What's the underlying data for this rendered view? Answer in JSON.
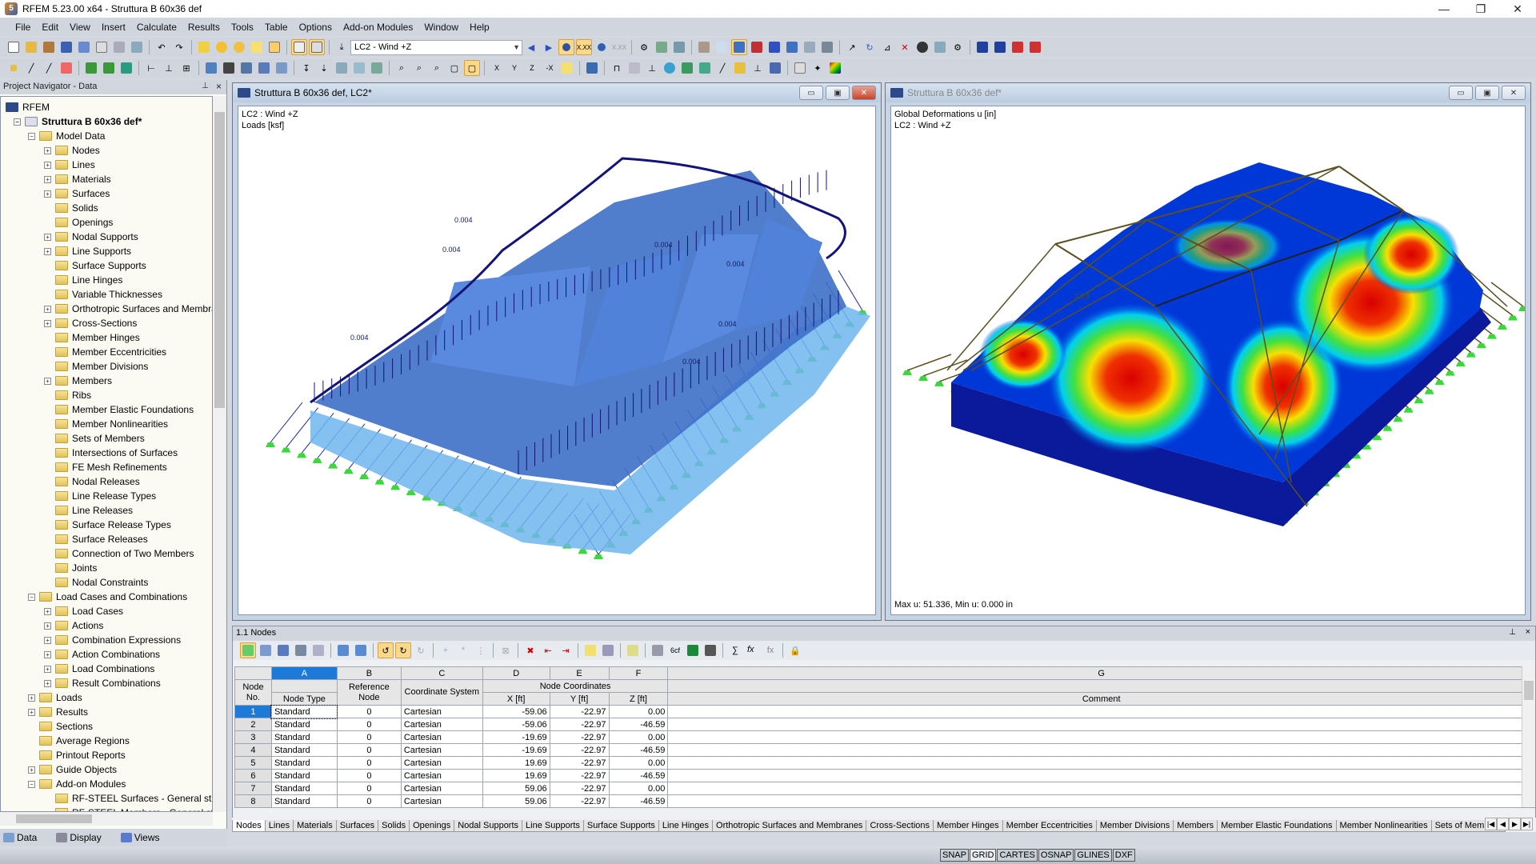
{
  "window": {
    "title": "RFEM 5.23.00 x64 - Struttura B 60x36 def",
    "app_icon": "rfem-5-icon"
  },
  "window_controls": {
    "minimize": "—",
    "restore": "❐",
    "close": "✕"
  },
  "menu": [
    "File",
    "Edit",
    "View",
    "Insert",
    "Calculate",
    "Results",
    "Tools",
    "Table",
    "Options",
    "Add-on Modules",
    "Window",
    "Help"
  ],
  "toolbar": {
    "load_case_selected": "LC2 - Wind +Z"
  },
  "navigator": {
    "title": "Project Navigator - Data",
    "items": [
      {
        "label": "RFEM",
        "level": 0,
        "expand": ""
      },
      {
        "label": "Struttura B 60x36 def*",
        "level": 1,
        "expand": "-",
        "bold": true
      },
      {
        "label": "Model Data",
        "level": 2,
        "expand": "-"
      },
      {
        "label": "Nodes",
        "level": 3,
        "expand": "+"
      },
      {
        "label": "Lines",
        "level": 3,
        "expand": "+"
      },
      {
        "label": "Materials",
        "level": 3,
        "expand": "+"
      },
      {
        "label": "Surfaces",
        "level": 3,
        "expand": "+"
      },
      {
        "label": "Solids",
        "level": 3,
        "expand": ""
      },
      {
        "label": "Openings",
        "level": 3,
        "expand": ""
      },
      {
        "label": "Nodal Supports",
        "level": 3,
        "expand": "+"
      },
      {
        "label": "Line Supports",
        "level": 3,
        "expand": "+"
      },
      {
        "label": "Surface Supports",
        "level": 3,
        "expand": ""
      },
      {
        "label": "Line Hinges",
        "level": 3,
        "expand": ""
      },
      {
        "label": "Variable Thicknesses",
        "level": 3,
        "expand": ""
      },
      {
        "label": "Orthotropic Surfaces and Membranes",
        "level": 3,
        "expand": "+"
      },
      {
        "label": "Cross-Sections",
        "level": 3,
        "expand": "+"
      },
      {
        "label": "Member Hinges",
        "level": 3,
        "expand": ""
      },
      {
        "label": "Member Eccentricities",
        "level": 3,
        "expand": ""
      },
      {
        "label": "Member Divisions",
        "level": 3,
        "expand": ""
      },
      {
        "label": "Members",
        "level": 3,
        "expand": "+"
      },
      {
        "label": "Ribs",
        "level": 3,
        "expand": ""
      },
      {
        "label": "Member Elastic Foundations",
        "level": 3,
        "expand": ""
      },
      {
        "label": "Member Nonlinearities",
        "level": 3,
        "expand": ""
      },
      {
        "label": "Sets of Members",
        "level": 3,
        "expand": ""
      },
      {
        "label": "Intersections of Surfaces",
        "level": 3,
        "expand": ""
      },
      {
        "label": "FE Mesh Refinements",
        "level": 3,
        "expand": ""
      },
      {
        "label": "Nodal Releases",
        "level": 3,
        "expand": ""
      },
      {
        "label": "Line Release Types",
        "level": 3,
        "expand": ""
      },
      {
        "label": "Line Releases",
        "level": 3,
        "expand": ""
      },
      {
        "label": "Surface Release Types",
        "level": 3,
        "expand": ""
      },
      {
        "label": "Surface Releases",
        "level": 3,
        "expand": ""
      },
      {
        "label": "Connection of Two Members",
        "level": 3,
        "expand": ""
      },
      {
        "label": "Joints",
        "level": 3,
        "expand": ""
      },
      {
        "label": "Nodal Constraints",
        "level": 3,
        "expand": ""
      },
      {
        "label": "Load Cases and Combinations",
        "level": 2,
        "expand": "-"
      },
      {
        "label": "Load Cases",
        "level": 3,
        "expand": "+"
      },
      {
        "label": "Actions",
        "level": 3,
        "expand": "+"
      },
      {
        "label": "Combination Expressions",
        "level": 3,
        "expand": "+"
      },
      {
        "label": "Action Combinations",
        "level": 3,
        "expand": "+"
      },
      {
        "label": "Load Combinations",
        "level": 3,
        "expand": "+"
      },
      {
        "label": "Result Combinations",
        "level": 3,
        "expand": "+"
      },
      {
        "label": "Loads",
        "level": 2,
        "expand": "+"
      },
      {
        "label": "Results",
        "level": 2,
        "expand": "+"
      },
      {
        "label": "Sections",
        "level": 2,
        "expand": ""
      },
      {
        "label": "Average Regions",
        "level": 2,
        "expand": ""
      },
      {
        "label": "Printout Reports",
        "level": 2,
        "expand": ""
      },
      {
        "label": "Guide Objects",
        "level": 2,
        "expand": "+"
      },
      {
        "label": "Add-on Modules",
        "level": 2,
        "expand": "-"
      },
      {
        "label": "RF-STEEL Surfaces - General stress",
        "level": 3,
        "expand": ""
      },
      {
        "label": "RF-STEEL Members - General stress",
        "level": 3,
        "expand": ""
      }
    ],
    "tabs": [
      "Data",
      "Display",
      "Views"
    ]
  },
  "left_view": {
    "title": "Struttura B 60x36 def, LC2*",
    "line1": "LC2 : Wind +Z",
    "line2": "Loads [ksf]",
    "load_labels": [
      "0.004",
      "0.004",
      "0.004",
      "0.004",
      "0.004",
      "0.004",
      "0.004"
    ]
  },
  "right_view": {
    "title": "Struttura B 60x36 def*",
    "line1": "Global Deformations u [in]",
    "line2": "LC2 : Wind +Z",
    "footer": "Max u: 51.336, Min u: 0.000 in",
    "annotation": "303.9"
  },
  "table": {
    "title": "1.1 Nodes",
    "col_letters": [
      "A",
      "B",
      "C",
      "D",
      "E",
      "F",
      "G"
    ],
    "headers": {
      "node_no": "Node No.",
      "node_type": "Node Type",
      "ref_node": "Reference Node",
      "coord_sys": "Coordinate System",
      "node_coords": "Node Coordinates",
      "x": "X [ft]",
      "y": "Y [ft]",
      "z": "Z [ft]",
      "comment": "Comment"
    },
    "rows": [
      {
        "no": "1",
        "type": "Standard",
        "ref": "0",
        "sys": "Cartesian",
        "x": "-59.06",
        "y": "-22.97",
        "z": "0.00",
        "comment": ""
      },
      {
        "no": "2",
        "type": "Standard",
        "ref": "0",
        "sys": "Cartesian",
        "x": "-59.06",
        "y": "-22.97",
        "z": "-46.59",
        "comment": ""
      },
      {
        "no": "3",
        "type": "Standard",
        "ref": "0",
        "sys": "Cartesian",
        "x": "-19.69",
        "y": "-22.97",
        "z": "0.00",
        "comment": ""
      },
      {
        "no": "4",
        "type": "Standard",
        "ref": "0",
        "sys": "Cartesian",
        "x": "-19.69",
        "y": "-22.97",
        "z": "-46.59",
        "comment": ""
      },
      {
        "no": "5",
        "type": "Standard",
        "ref": "0",
        "sys": "Cartesian",
        "x": "19.69",
        "y": "-22.97",
        "z": "0.00",
        "comment": ""
      },
      {
        "no": "6",
        "type": "Standard",
        "ref": "0",
        "sys": "Cartesian",
        "x": "19.69",
        "y": "-22.97",
        "z": "-46.59",
        "comment": ""
      },
      {
        "no": "7",
        "type": "Standard",
        "ref": "0",
        "sys": "Cartesian",
        "x": "59.06",
        "y": "-22.97",
        "z": "0.00",
        "comment": ""
      },
      {
        "no": "8",
        "type": "Standard",
        "ref": "0",
        "sys": "Cartesian",
        "x": "59.06",
        "y": "-22.97",
        "z": "-46.59",
        "comment": ""
      }
    ]
  },
  "table_tabs": [
    "Nodes",
    "Lines",
    "Materials",
    "Surfaces",
    "Solids",
    "Openings",
    "Nodal Supports",
    "Line Supports",
    "Surface Supports",
    "Line Hinges",
    "Orthotropic Surfaces and Membranes",
    "Cross-Sections",
    "Member Hinges",
    "Member Eccentricities",
    "Member Divisions",
    "Members",
    "Member Elastic Foundations",
    "Member Nonlinearities",
    "Sets of Members"
  ],
  "status_toggles": [
    {
      "label": "SNAP",
      "on": false
    },
    {
      "label": "GRID",
      "on": true
    },
    {
      "label": "CARTES",
      "on": false
    },
    {
      "label": "OSNAP",
      "on": false
    },
    {
      "label": "GLINES",
      "on": false
    },
    {
      "label": "DXF",
      "on": false
    }
  ],
  "colors": {
    "selection_blue": "#1e7ad8",
    "support_green": "#3ad83a",
    "load_navy": "#10107a",
    "active_toggle": "#fbd98a"
  }
}
